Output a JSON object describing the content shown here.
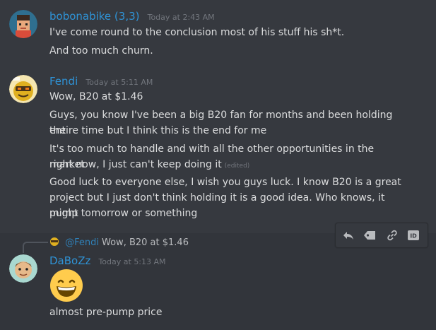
{
  "messages": [
    {
      "username": "bobonabike (3,3)",
      "timestamp": "Today at 2:43 AM",
      "lines": [
        "I've come round to the conclusion most of his stuff his sh*t.",
        "And too much churn."
      ]
    },
    {
      "username": "Fendi",
      "timestamp": "Today at 5:11 AM",
      "lines": [
        "Wow, B20 at $1.46",
        "Guys, you know I've been a big B20 fan for months and been holding the",
        "entire time but I think this is the end for me",
        "It's too much to handle and with all the other opportunities in the market",
        "right now, I just can't keep doing it",
        "Good luck to everyone else, I wish you guys luck. I know B20 is a great",
        "project but I just don't think holding it is a good idea. Who knows, it might",
        "pump tomorrow or something"
      ],
      "edited_label": "(edited)"
    },
    {
      "username": "DaBoZz",
      "timestamp": "Today at 5:13 AM",
      "reply": {
        "mention": "@Fendi",
        "text": "Wow, B20 at $1.46"
      },
      "emoji": "grinning-face-emoji",
      "lines": [
        "almost pre-pump price"
      ]
    }
  ],
  "toolbar": {
    "icons": [
      "reply-icon",
      "tag-icon",
      "link-icon",
      "id-icon"
    ],
    "id_label": "ID"
  },
  "colors": {
    "background": "#36393f",
    "hover_background": "#32353b",
    "username": "#2f93d6",
    "text": "#dcddde",
    "timestamp": "#72767d"
  }
}
